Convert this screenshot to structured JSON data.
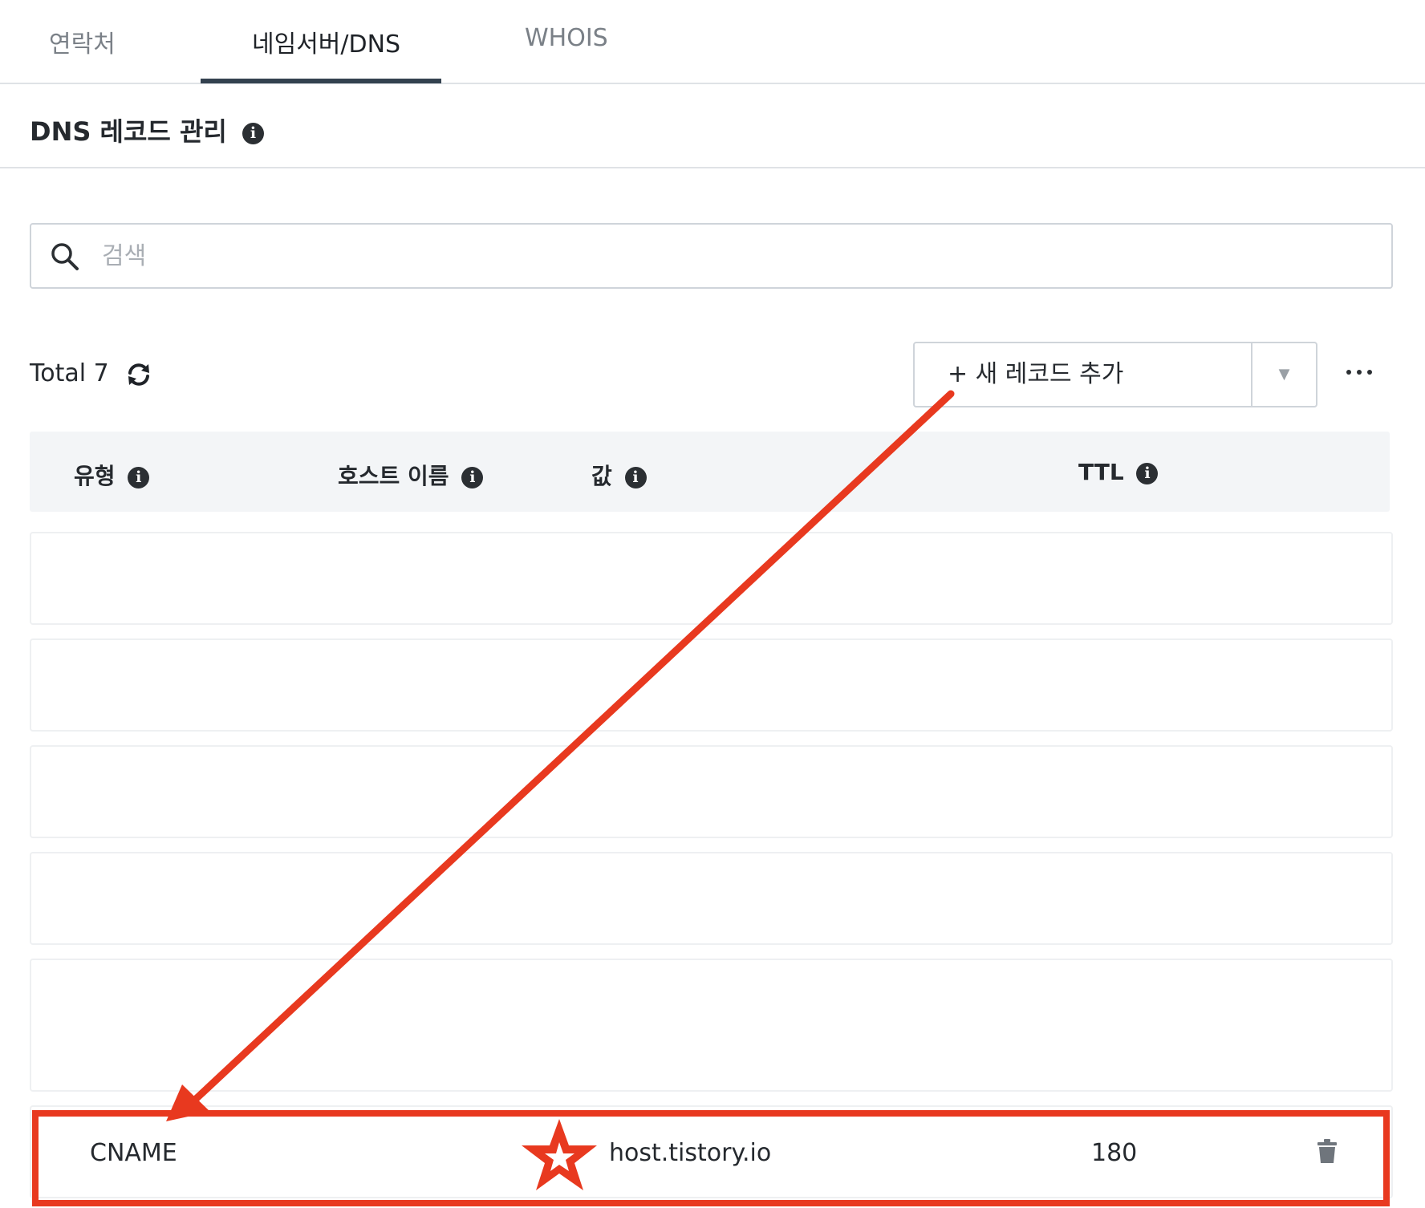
{
  "tabs": [
    {
      "label": "연락처",
      "active": false
    },
    {
      "label": "네임서버/DNS",
      "active": true
    },
    {
      "label": "WHOIS",
      "active": false
    }
  ],
  "section": {
    "title": "DNS 레코드 관리",
    "info_icon": "info-icon"
  },
  "search": {
    "placeholder": "검색",
    "value": "",
    "icon": "search-icon"
  },
  "toolbar": {
    "total_label": "Total 7",
    "refresh_icon": "refresh-icon",
    "add_button_label": "+ 새 레코드 추가",
    "dropdown_caret": "▼",
    "more_icon": "more-icon"
  },
  "table": {
    "columns": [
      {
        "label": "유형"
      },
      {
        "label": "호스트 이름"
      },
      {
        "label": "값"
      },
      {
        "label": "TTL"
      }
    ],
    "visible_record": {
      "type": "CNAME",
      "host": "",
      "value": "host.tistory.io",
      "ttl": "180",
      "delete_icon": "trash-icon"
    }
  },
  "annotation": {
    "color": "#e8391f",
    "marker_icon": "star-icon",
    "arrow_icon": "arrow-icon"
  }
}
